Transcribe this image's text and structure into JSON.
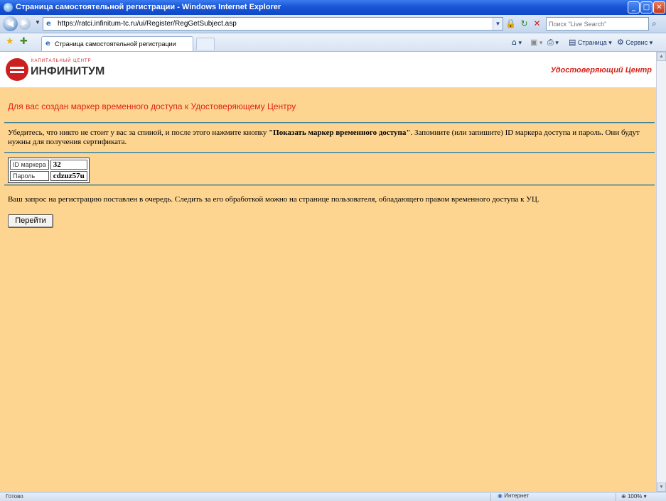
{
  "window": {
    "title": "Страница самостоятельной регистрации - Windows Internet Explorer",
    "min": "_",
    "max": "□",
    "close": "✕"
  },
  "address": {
    "url": "https://ratci.infinitum-tc.ru/ui/Register/RegGetSubject.asp",
    "search_placeholder": "Поиск \"Live Search\""
  },
  "tabs": [
    {
      "label": "Страница самостоятельной регистрации"
    }
  ],
  "commands": {
    "page": "Страница",
    "tools": "Сервис"
  },
  "header": {
    "logo_small": "КАПИТАЛЬНЫЙ ЦЕНТР",
    "logo_big": "ИНФИНИТУМ",
    "center_name": "Удостоверяющий Центр"
  },
  "main": {
    "heading": "Для вас создан маркер временного доступа к Удостоверяющему Центру",
    "intro_before": "Убедитесь, что никто не стоит у вас за спиной, и после этого нажмите кнопку ",
    "intro_bold": "\"Показать маркер временного доступа\"",
    "intro_after": ". Запомните (или запишите) ID маркера доступа и пароль. Они будут нужны для получения сертификата.",
    "credentials": {
      "id_label": "ID маркера",
      "id_value": "32",
      "password_label": "Пароль",
      "password_value": "cdzuz57u"
    },
    "queue_text": "Ваш запрос на регистрацию поставлен в очередь. Следить за его обработкой можно на странице пользователя, обладающего правом временного доступа к УЦ.",
    "go_button": "Перейти"
  },
  "status": {
    "text": "Готово",
    "zone": "Интернет",
    "zoom": "100%"
  }
}
